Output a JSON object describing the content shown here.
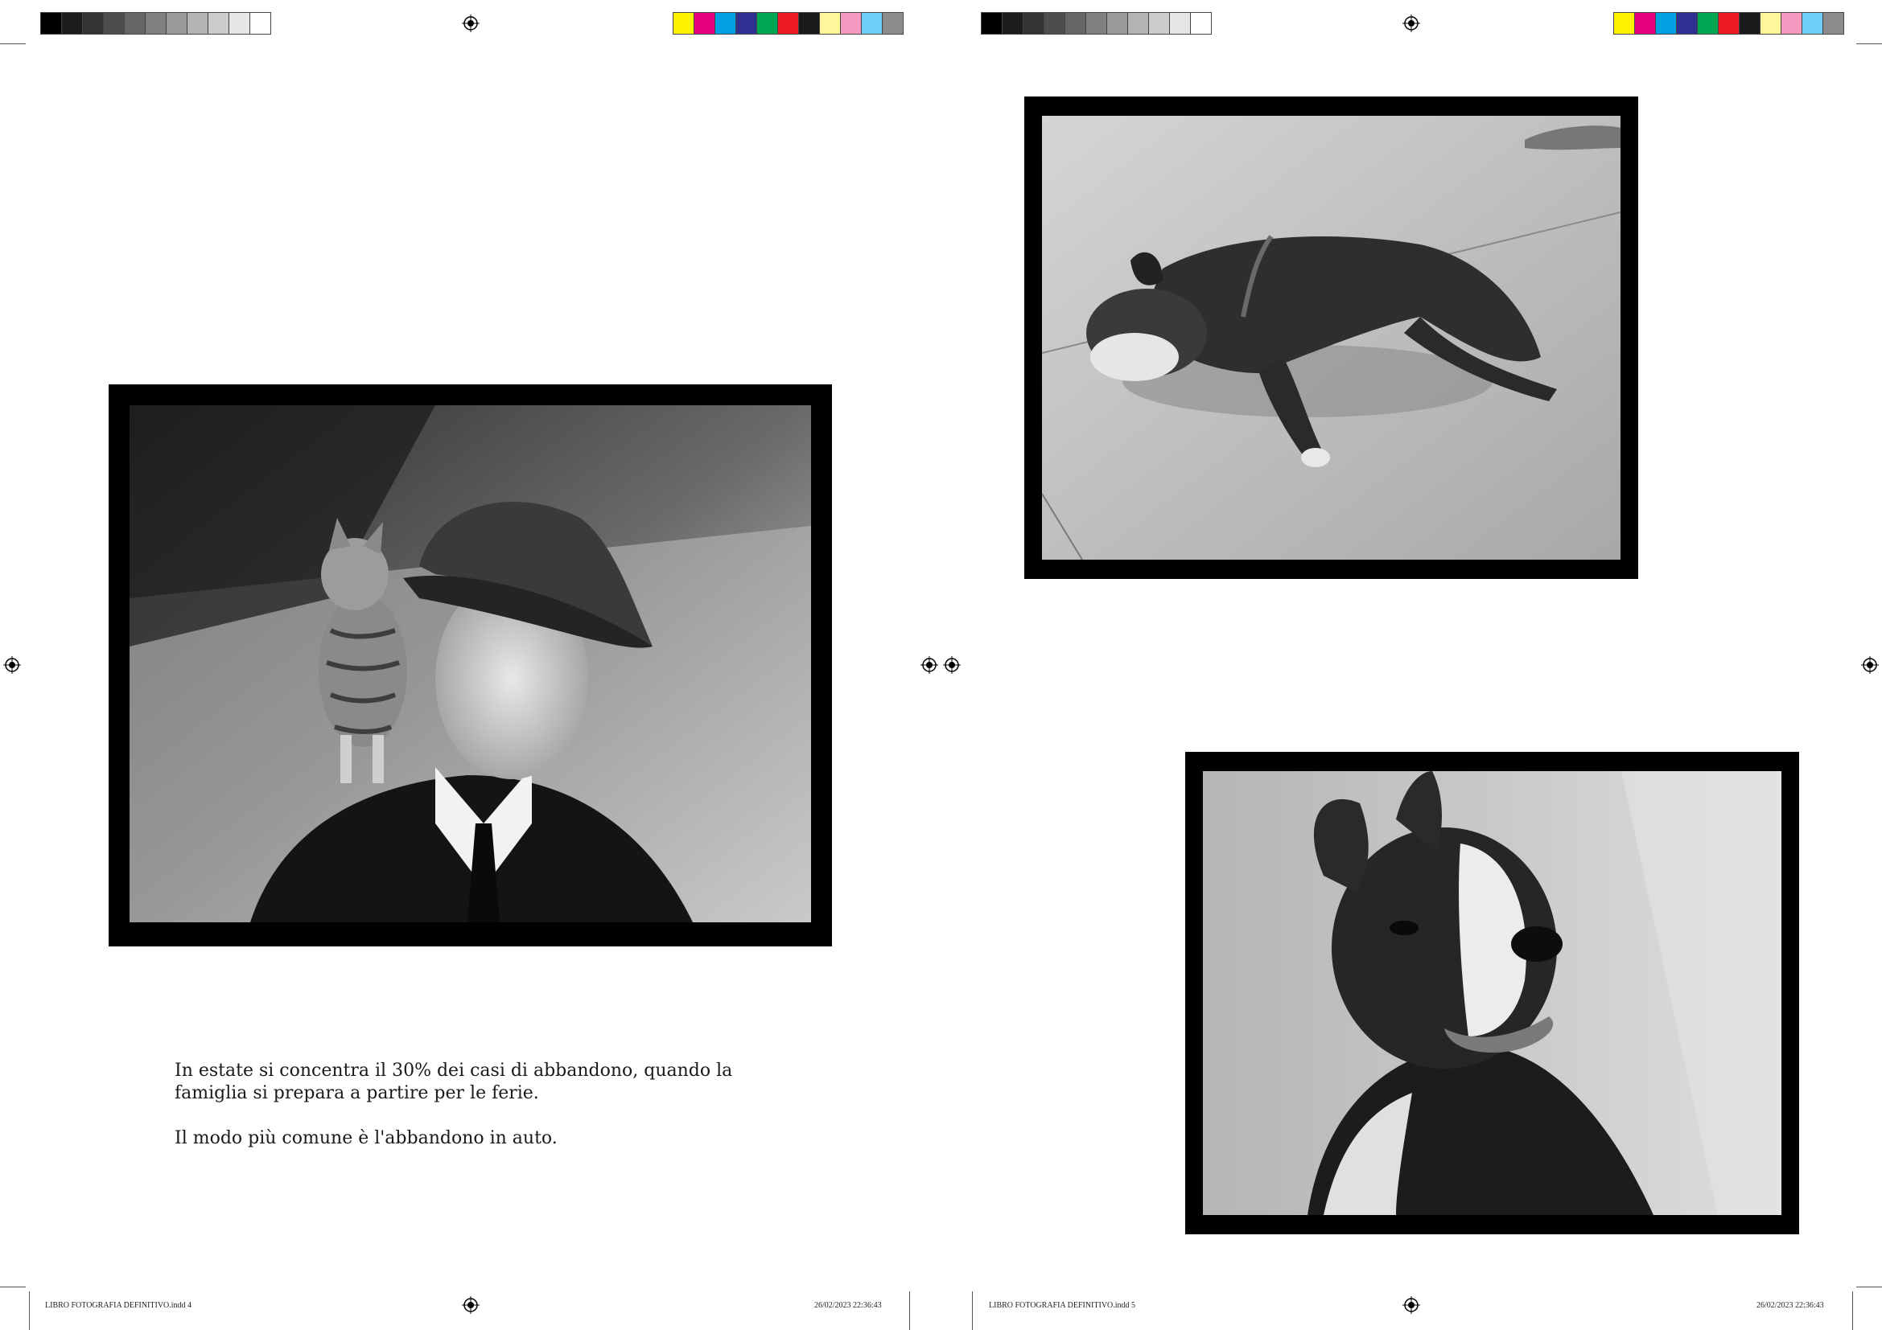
{
  "left_page": {
    "body_paragraphs": [
      "In estate si concentra il 30% dei casi di abbandono, quando la famiglia si prepara a partire per le ferie.",
      "Il modo più comune è l'abbandono in auto."
    ],
    "slug_file": "LIBRO FOTOGRAFIA DEFINITIVO.indd   4",
    "slug_datetime": "26/02/2023   22:36:43"
  },
  "right_page": {
    "slug_file": "LIBRO FOTOGRAFIA DEFINITIVO.indd   5",
    "slug_datetime": "26/02/2023   22:36:43"
  },
  "print_marks": {
    "gray_swatches": [
      "#000000",
      "#1c1c1c",
      "#333333",
      "#4d4d4d",
      "#666666",
      "#808080",
      "#999999",
      "#b3b3b3",
      "#cccccc",
      "#e6e6e6",
      "#ffffff"
    ],
    "color_swatches": [
      "#fff200",
      "#e6007e",
      "#00a0e3",
      "#2e3192",
      "#00a651",
      "#ed1c24",
      "#1a1a1a",
      "#fff799",
      "#f49ac1",
      "#6dcff6",
      "#8c8c8c"
    ]
  },
  "photos": [
    {
      "id": "man-with-cat",
      "icon": "photo-man-with-kitten"
    },
    {
      "id": "sleeping-dog",
      "icon": "photo-sleeping-boston-terrier"
    },
    {
      "id": "dog-portrait",
      "icon": "photo-boston-terrier-portrait"
    }
  ]
}
